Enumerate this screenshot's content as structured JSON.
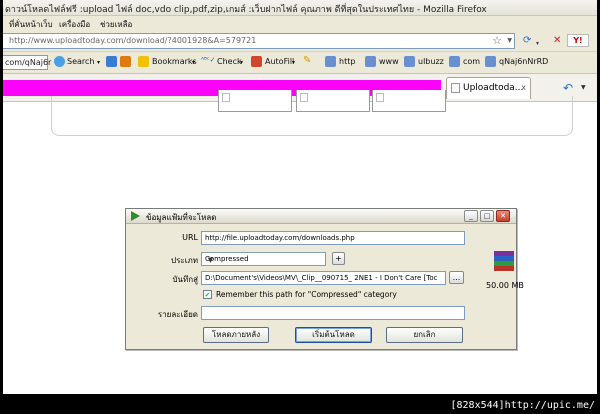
{
  "window": {
    "title": "ดาวน์โหลดไฟล์ฟรี :upload ไฟล์ doc,vdo clip,pdf,zip,เกมส์ :เว็บฝากไฟล์ คุณภาพ ดีที่สุดในประเทศไทย - Mozilla Firefox"
  },
  "menu": {
    "items": [
      "ที่คั่นหน้าเว็บ",
      "เครื่องมือ",
      "ช่วยเหลือ"
    ]
  },
  "nav": {
    "url": "http://www.uploadtoday.com/download/?4001928&A=579721",
    "yahoo_label": "Y!"
  },
  "toolbar": {
    "search_value": "com/qNaj6r",
    "items": [
      "Search",
      "Bookmarks",
      "Check",
      "AutoFill",
      "http",
      "www",
      "ulbuzz",
      "com",
      "qNaj6nNrRD"
    ]
  },
  "tabs": [
    {
      "label": "Uploadtoda...",
      "close": "x"
    }
  ],
  "dialog": {
    "title": "ข้อมูลแฟ้มที่จะโหลด",
    "url_label": "URL",
    "url_value": "http://file.uploadtoday.com/downloads.php",
    "category_label": "ประเภท",
    "category_value": "Compressed",
    "add_button": "+",
    "saveas_label": "บันทึกสู่",
    "saveas_value": "D:\\Document's\\Videos\\MV\\_Clip__090715_ 2NE1 - I Don't Care [Toc",
    "browse_button": "...",
    "remember_checked": true,
    "remember_label": "Remember this path for \"Compressed\" category",
    "description_label": "รายละเอียด",
    "description_value": "",
    "file_size": "50.00 MB",
    "buttons": {
      "later": "โหลดภายหลัง",
      "start": "เริ่มต้นโหลด",
      "cancel": "ยกเลิก"
    }
  },
  "watermark": "[828x544]http://upic.me/"
}
